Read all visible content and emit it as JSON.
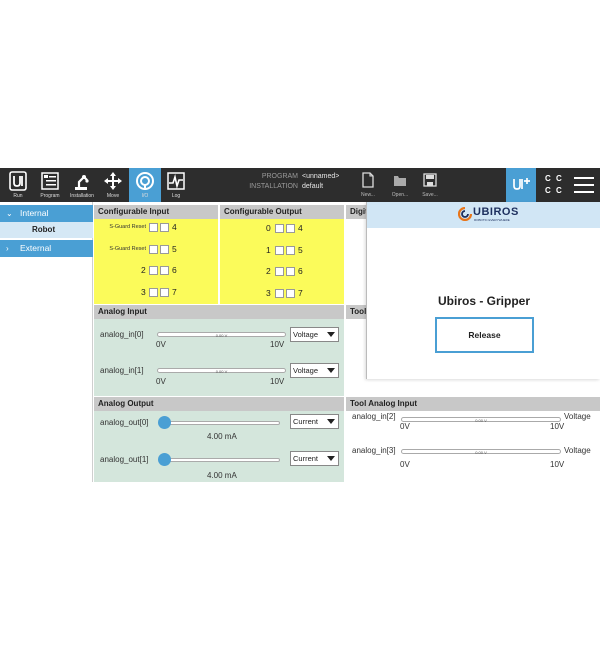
{
  "nav": [
    {
      "label": "Run",
      "icon": "ur-logo-icon"
    },
    {
      "label": "Program",
      "icon": "program-icon"
    },
    {
      "label": "Installation",
      "icon": "robot-arm-icon"
    },
    {
      "label": "Move",
      "icon": "move-arrows-icon"
    },
    {
      "label": "I/O",
      "icon": "io-icon",
      "active": true
    },
    {
      "label": "Log",
      "icon": "log-chart-icon"
    }
  ],
  "program": {
    "program_label": "PROGRAM",
    "program_value": "<unnamed>",
    "installation_label": "INSTALLATION",
    "installation_value": "default"
  },
  "file_buttons": [
    {
      "label": "New...",
      "icon": "new-file-icon"
    },
    {
      "label": "Open...",
      "icon": "open-folder-icon"
    },
    {
      "label": "Save...",
      "icon": "save-icon"
    }
  ],
  "cc_badges": [
    "C",
    "C",
    "C",
    "C"
  ],
  "sidebar": {
    "internal": "Internal",
    "robot": "Robot",
    "external": "External"
  },
  "configurable_input": {
    "title": "Configurable Input",
    "rows": [
      {
        "label": "S-Guard Reset",
        "left": "",
        "right": "4"
      },
      {
        "label": "S-Guard Reset",
        "left": "",
        "right": "5"
      },
      {
        "label": "",
        "left": "2",
        "right": "6"
      },
      {
        "label": "",
        "left": "3",
        "right": "7"
      }
    ]
  },
  "configurable_output": {
    "title": "Configurable Output",
    "rows": [
      {
        "left": "0",
        "right": "4"
      },
      {
        "left": "1",
        "right": "5"
      },
      {
        "left": "2",
        "right": "6"
      },
      {
        "left": "3",
        "right": "7"
      }
    ]
  },
  "digital_header": "Digit",
  "tool_header": "Tool",
  "analog_input": {
    "title": "Analog Input",
    "items": [
      {
        "name": "analog_in[0]",
        "value": "0.00 V",
        "min": "0V",
        "max": "10V",
        "mode": "Voltage"
      },
      {
        "name": "analog_in[1]",
        "value": "0.00 V",
        "min": "0V",
        "max": "10V",
        "mode": "Voltage"
      }
    ]
  },
  "analog_output": {
    "title": "Analog Output",
    "items": [
      {
        "name": "analog_out[0]",
        "value": "4.00 mA",
        "mode": "Current"
      },
      {
        "name": "analog_out[1]",
        "value": "4.00 mA",
        "mode": "Current"
      }
    ]
  },
  "tool_analog_input": {
    "title": "Tool Analog Input",
    "items": [
      {
        "name": "analog_in[2]",
        "value": "0.00 V",
        "min": "0V",
        "max": "10V",
        "mode": "Voltage"
      },
      {
        "name": "analog_in[3]",
        "value": "0.00 V",
        "min": "0V",
        "max": "10V",
        "mode": "Voltage"
      }
    ]
  },
  "popup": {
    "logo_text": "UBIROS",
    "logo_tagline": "ROBOTIC EVERYWHERE",
    "title": "Ubiros - Gripper",
    "button": "Release"
  },
  "colors": {
    "accent": "#4a9fd4",
    "topbar": "#2d2d2d",
    "io_yellow": "#fbfb5a",
    "analog_green": "#d4e6dc",
    "logo_orange": "#e8751a",
    "logo_navy": "#1d2f5e"
  }
}
